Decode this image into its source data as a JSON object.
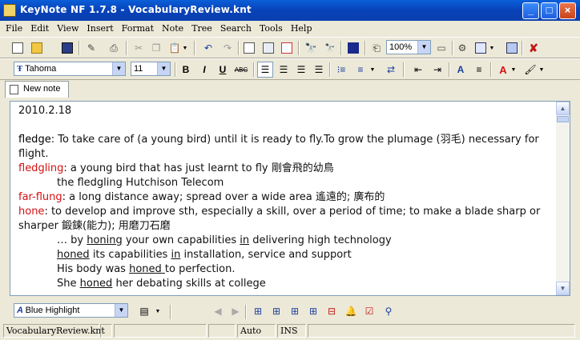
{
  "window": {
    "title": "KeyNote NF  1.7.8 - VocabularyReview.knt"
  },
  "menu": [
    "File",
    "Edit",
    "View",
    "Insert",
    "Format",
    "Note",
    "Tree",
    "Search",
    "Tools",
    "Help"
  ],
  "toolbar": {
    "zoom": "100%",
    "font": "Tahoma",
    "size": "11"
  },
  "tabs": [
    {
      "label": "New note"
    }
  ],
  "editor": {
    "date": "2010.2.18",
    "entries": {
      "fledge_term": "fledge",
      "fledge_def": ": To take care of (a young bird) until it is ready to fly.To grow the plumage (羽毛) necessary for flight.",
      "fledgling_term": "fledgling",
      "fledgling_def": ": a young bird that has just learnt to fly 剛會飛的幼鳥",
      "fledgling_ex": "the fledgling Hutchison Telecom",
      "farflung_term": "far-flung",
      "farflung_def": ": a long distance away; spread over a wide area 遙遠的; 廣布的",
      "hone_term": "hone",
      "hone_def": ": to develop and improve sth, especially a skill, over a period of time; to make a blade sharp or sharper 鍛鍊(能力); 用磨刀石磨",
      "hone_ex1": {
        "a": "… by ",
        "u1": "honing",
        "b": " your own capabilities ",
        "u2": "in",
        "c": " delivering high technology"
      },
      "hone_ex2": {
        "u1": "honed",
        "a": " its capabilities ",
        "u2": "in",
        "b": " installation, service and support"
      },
      "hone_ex3": {
        "a": "His body was ",
        "u1": "honed ",
        "b": "to perfection."
      },
      "hone_ex4": {
        "a": "She ",
        "u1": "honed",
        "b": " her debating skills at college"
      }
    }
  },
  "bottom": {
    "style": "Blue Highlight"
  },
  "status": {
    "file": "VocabularyReview.knt",
    "mode": "Auto",
    "ins": "INS"
  },
  "colors": {
    "term_red": "#d51010",
    "title_blue": "#0a5fd8"
  }
}
